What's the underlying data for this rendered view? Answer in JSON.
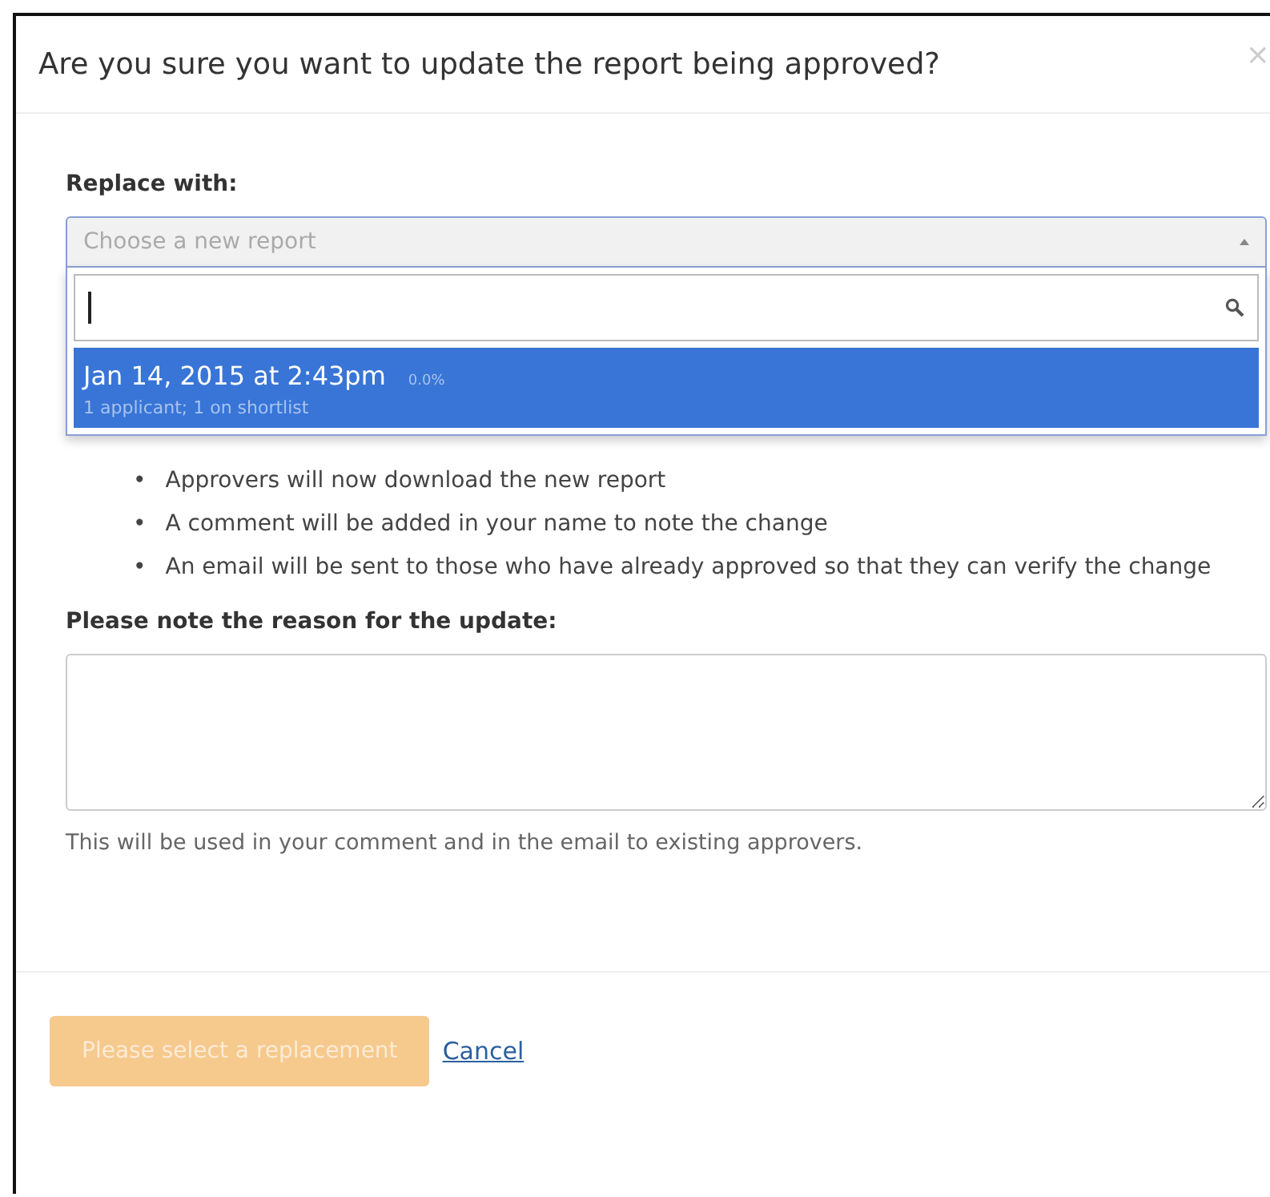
{
  "dialog": {
    "title": "Are you sure you want to update the report being approved?",
    "close": "×"
  },
  "replace": {
    "label": "Replace with:",
    "placeholder": "Choose a new report",
    "expanded": true,
    "options": [
      {
        "title": "Jan 14, 2015 at 2:43pm",
        "score": "0.0%",
        "detail": "1 applicant; 1 on shortlist",
        "selected": true
      }
    ]
  },
  "bullets": [
    {
      "marker": "•",
      "text": "Approvers will now download the new report"
    },
    {
      "marker": "•",
      "text": "A comment will be added in your name to note the change"
    },
    {
      "marker": "•",
      "text": "An email will be sent to those who have already approved so that they can verify the change"
    }
  ],
  "reason": {
    "label": "Please note the reason for the update:",
    "help": "This will be used in your comment and in the email to existing approvers."
  },
  "footer": {
    "submit": {
      "label": "Please select a replacement",
      "disabled": true
    },
    "cancel": "Cancel"
  }
}
